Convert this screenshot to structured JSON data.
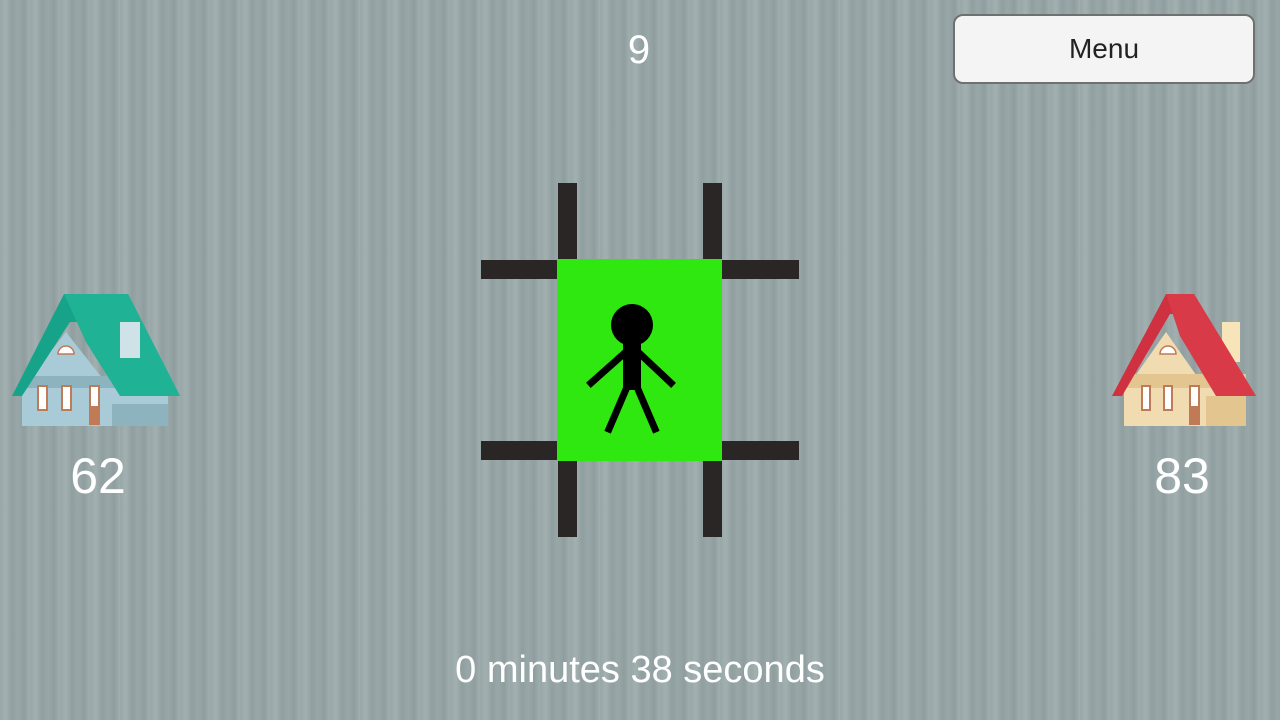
{
  "hud": {
    "top_counter": "9",
    "menu_label": "Menu",
    "timer": "0 minutes 38 seconds"
  },
  "left_house": {
    "score": "62",
    "roof_color": "#1aa88c",
    "wall_color": "#a9cbd7"
  },
  "right_house": {
    "score": "83",
    "roof_color": "#cf3140",
    "wall_color": "#f0dcb0"
  },
  "board": {
    "tile_color": "#2fe80f",
    "grid_color": "#2a2626"
  },
  "icons": {
    "player": "stick-figure-icon",
    "left_house": "house-icon",
    "right_house": "house-icon"
  }
}
